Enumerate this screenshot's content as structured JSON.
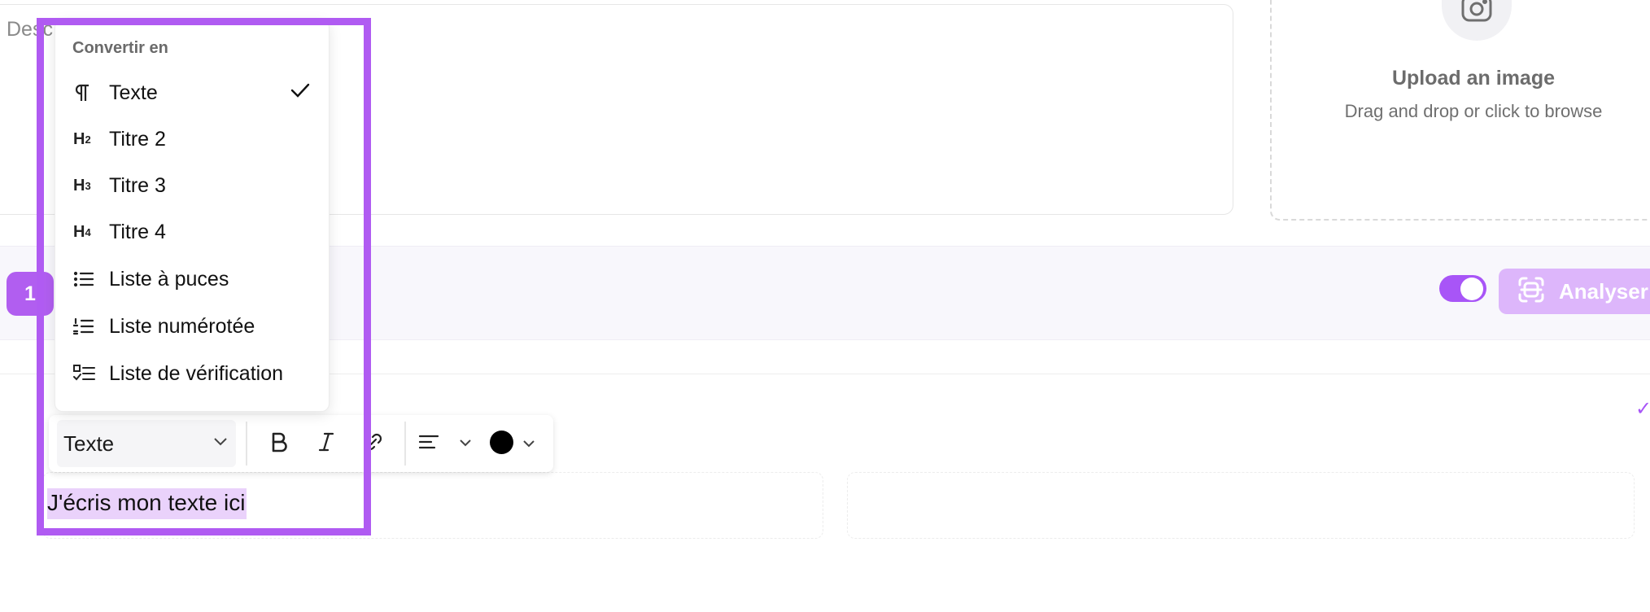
{
  "description_card": {
    "placeholder": "Desc"
  },
  "upload": {
    "icon": "instagram-camera-icon",
    "title": "Upload an image",
    "subtitle": "Drag and drop or click to browse"
  },
  "band": {
    "step_badge": "1",
    "analyze_label": "Analyser",
    "toggle_on": true
  },
  "dropdown": {
    "header": "Convertir en",
    "items": [
      {
        "label": "Texte",
        "icon": "paragraph-icon",
        "checked": true
      },
      {
        "label": "Titre 2",
        "icon": "heading-2-icon",
        "checked": false
      },
      {
        "label": "Titre 3",
        "icon": "heading-3-icon",
        "checked": false
      },
      {
        "label": "Titre 4",
        "icon": "heading-4-icon",
        "checked": false
      },
      {
        "label": "Liste à puces",
        "icon": "bullet-list-icon",
        "checked": false
      },
      {
        "label": "Liste numérotée",
        "icon": "numbered-list-icon",
        "checked": false
      },
      {
        "label": "Liste de vérification",
        "icon": "checklist-icon",
        "checked": false
      }
    ]
  },
  "toolbar": {
    "block_type": "Texte",
    "text_color": "#000000"
  },
  "editor": {
    "text": "J'écris mon texte ici"
  },
  "colors": {
    "accent": "#a855f7",
    "highlight": "#b05bf2",
    "selection": "#ead2fb"
  }
}
